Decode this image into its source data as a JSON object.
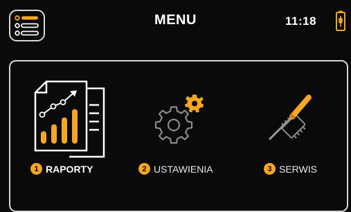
{
  "header": {
    "title": "MENU",
    "time": "11:18",
    "menu_icon": "list-menu-icon",
    "battery_icon": "battery-charging-icon"
  },
  "tiles": [
    {
      "number": "1",
      "label": "RAPORTY",
      "icon": "report-chart-icon",
      "selected": true
    },
    {
      "number": "2",
      "label": "USTAWIENIA",
      "icon": "settings-gears-icon",
      "selected": false
    },
    {
      "number": "3",
      "label": "SERWIS",
      "icon": "service-screwdriver-chip-icon",
      "selected": false
    }
  ],
  "colors": {
    "accent": "#f5a623",
    "foreground": "#ffffff",
    "inactive_icon": "#8a8a8a",
    "background": "#0a0a0a"
  }
}
